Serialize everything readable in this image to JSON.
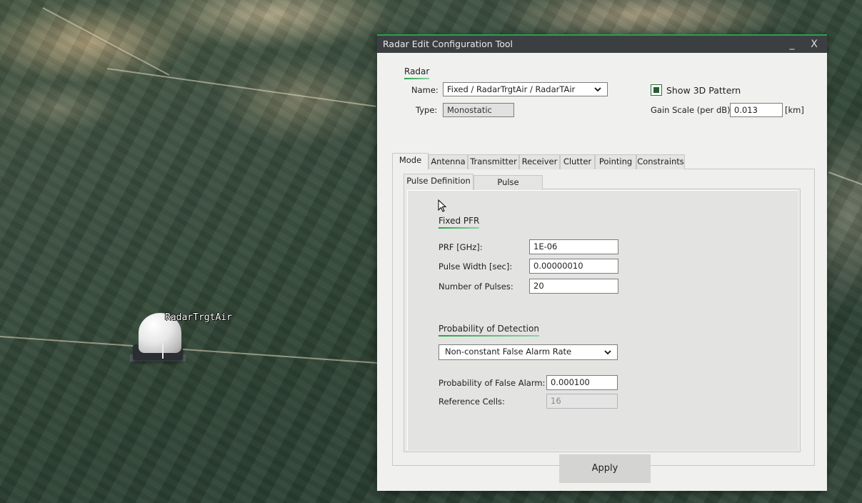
{
  "map": {
    "radar_label": "RadarTrgtAir"
  },
  "window": {
    "title": "Radar Edit Configuration Tool",
    "minimize_glyph": "_",
    "close_glyph": "X"
  },
  "radar": {
    "section_title": "Radar",
    "name_label": "Name:",
    "name_value": "Fixed / RadarTrgtAir / RadarTAir",
    "type_label": "Type:",
    "type_value": "Monostatic",
    "show_3d_label": "Show 3D Pattern",
    "show_3d_checked": true,
    "gain_scale_label": "Gain Scale (per dB):",
    "gain_scale_value": "0.013",
    "gain_scale_unit": "[km]"
  },
  "tabs": [
    "Mode",
    "Antenna",
    "Transmitter",
    "Receiver",
    "Clutter",
    "Pointing",
    "Constraints"
  ],
  "active_tab": "Mode",
  "subtabs": [
    "Pulse Definition",
    "Pulse Integration"
  ],
  "active_subtab": "Pulse Definition",
  "fixed_pfr": {
    "section_title": "Fixed PFR",
    "prf_label": "PRF [GHz]:",
    "prf_value": "1E-06",
    "pulse_width_label": "Pulse Width [sec]:",
    "pulse_width_value": "0.00000010",
    "num_pulses_label": "Number of Pulses:",
    "num_pulses_value": "20"
  },
  "pod": {
    "section_title": "Probability of Detection",
    "method_value": "Non-constant False Alarm Rate",
    "pfa_label": "Probability of False Alarm:",
    "pfa_value": "0.000100",
    "ref_cells_label": "Reference Cells:",
    "ref_cells_value": "16"
  },
  "apply_label": "Apply",
  "icons": {
    "dropdown": "chevron-down-icon",
    "checkbox": "checkbox-icon",
    "cursor": "mouse-pointer-icon"
  },
  "colors": {
    "accent": "#2aa14b",
    "titlebar": "#3b3f42",
    "window_bg": "#f0f0ee"
  }
}
